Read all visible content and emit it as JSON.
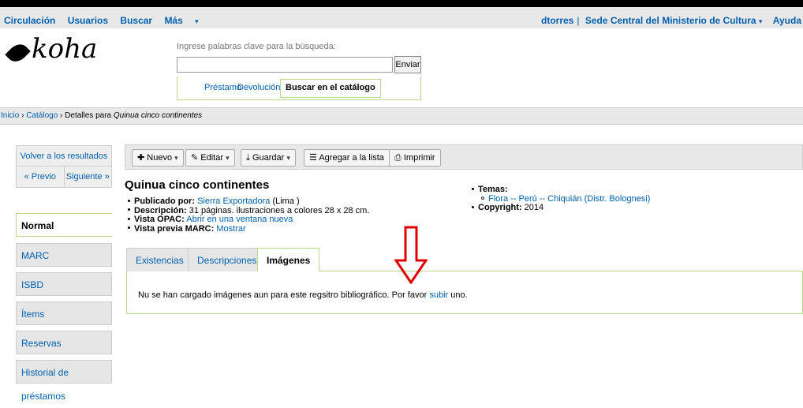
{
  "topnav": {
    "left": [
      "Circulación",
      "Usuarios",
      "Buscar",
      "Más"
    ],
    "user": "dtorres",
    "library": "Sede Central del Ministerio de Cultura",
    "help": "Ayuda"
  },
  "logo": "koha",
  "search": {
    "label": "Ingrese palabras clave para la búsqueda:",
    "value": "",
    "button": "Enviar",
    "tabs": [
      "Préstamo",
      "Devolución"
    ],
    "active_tab": "Buscar en el catálogo"
  },
  "breadcrumbs": {
    "home": "Inicio",
    "catalog": "Catálogo",
    "prefix": "Detalles para",
    "current": "Quinua cinco continentes"
  },
  "sidebar": {
    "back": "Volver a los resultados",
    "prev": "« Previo",
    "next": "Siguiente »",
    "views": [
      "Normal",
      "MARC",
      "ISBD",
      "Ítems",
      "Reservas",
      "Historial de préstamos"
    ]
  },
  "toolbar": {
    "new": "Nuevo",
    "edit": "Editar",
    "save": "Guardar",
    "add_list": "Agregar a la lista",
    "print": "Imprimir"
  },
  "record": {
    "title": "Quinua cinco continentes",
    "published_label": "Publicado por:",
    "publisher": "Sierra Exportadora",
    "place": "(Lima )",
    "description_label": "Descripción:",
    "description": "31 páginas. ilustraciones a colores 28 x 28 cm.",
    "opac_label": "Vista OPAC:",
    "opac_link": "Abrir en una ventana nueva",
    "marc_label": "Vista previa MARC:",
    "marc_link": "Mostrar",
    "subjects_label": "Temas:",
    "subjects": "Flora -- Perú -- Chiquián (Distr. Bolognesi)",
    "copyright_label": "Copyright:",
    "copyright": "2014"
  },
  "tabs": {
    "items": [
      "Existencias",
      "Descripciones",
      "Imágenes"
    ],
    "active": "Imágenes"
  },
  "images_panel": {
    "message": "Nu se han cargado imágenes aun para este regsitro bibliográfico. Por favor",
    "link": "subir",
    "suffix": "uno."
  },
  "colors": {
    "link": "#0060ad",
    "accent_border": "#b8d98b",
    "arrow": "#e00000"
  }
}
